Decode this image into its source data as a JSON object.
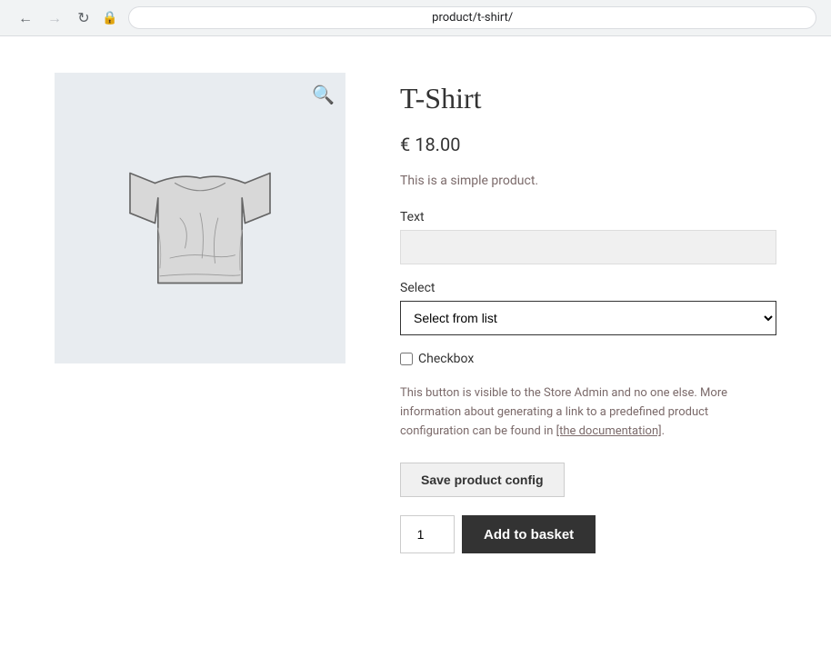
{
  "browser": {
    "url": "product/t-shirt/",
    "back_title": "Back",
    "forward_title": "Forward",
    "refresh_title": "Refresh"
  },
  "product": {
    "title": "T-Shirt",
    "price": "€ 18.00",
    "description": "This is a simple product.",
    "image_alt": "T-Shirt product image"
  },
  "form": {
    "text_label": "Text",
    "text_placeholder": "",
    "select_label": "Select",
    "select_default": "Select from list",
    "select_options": [
      "Select from list"
    ],
    "checkbox_label": "Checkbox"
  },
  "admin_notice": {
    "text_before_link": "This button is visible to the Store Admin and no one else. More information about generating a link to a predefined product configuration can be found in ",
    "link_text": "[the documentation]",
    "text_after_link": "."
  },
  "actions": {
    "save_config_label": "Save product config",
    "quantity_value": "1",
    "add_to_basket_label": "Add to basket"
  },
  "icons": {
    "zoom": "🔍",
    "back": "←",
    "forward": "→",
    "refresh": "↻",
    "lock": "🔒"
  }
}
